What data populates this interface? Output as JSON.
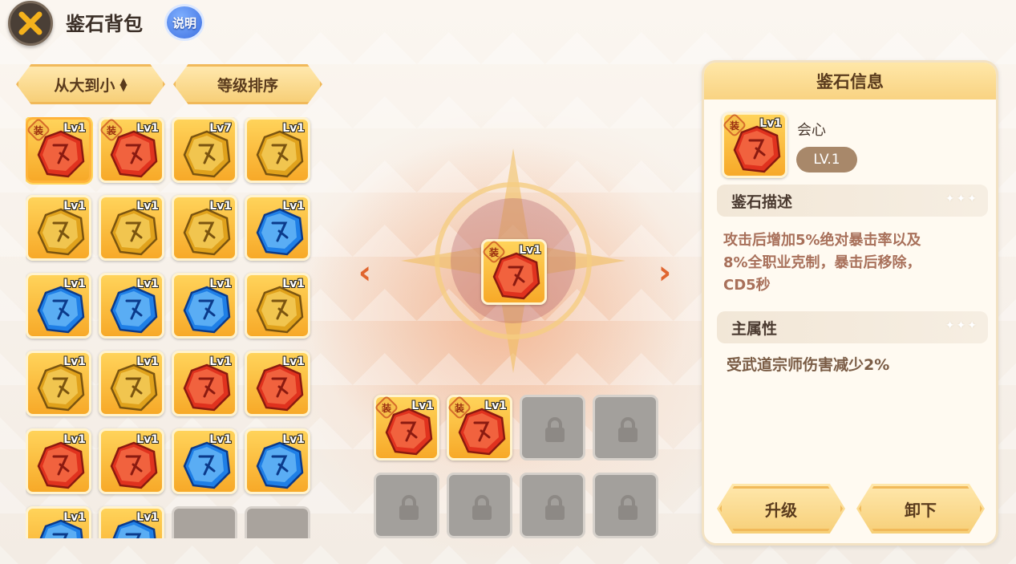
{
  "header": {
    "title": "鉴石背包",
    "help_label": "说明"
  },
  "sort": {
    "order_label": "从大到小",
    "level_label": "等级排序"
  },
  "equip_tag": "装",
  "bag": [
    {
      "color": "red",
      "lv": "Lv1",
      "equipped": true,
      "selected": true
    },
    {
      "color": "red",
      "lv": "Lv1",
      "equipped": true
    },
    {
      "color": "gold",
      "lv": "Lv7"
    },
    {
      "color": "gold",
      "lv": "Lv1"
    },
    {
      "color": "gold",
      "lv": "Lv1"
    },
    {
      "color": "gold",
      "lv": "Lv1"
    },
    {
      "color": "gold",
      "lv": "Lv1"
    },
    {
      "color": "blue",
      "lv": "Lv1"
    },
    {
      "color": "blue",
      "lv": "Lv1"
    },
    {
      "color": "blue",
      "lv": "Lv1"
    },
    {
      "color": "blue",
      "lv": "Lv1"
    },
    {
      "color": "gold",
      "lv": "Lv1"
    },
    {
      "color": "gold",
      "lv": "Lv1"
    },
    {
      "color": "gold",
      "lv": "Lv1"
    },
    {
      "color": "red",
      "lv": "Lv1"
    },
    {
      "color": "red",
      "lv": "Lv1"
    },
    {
      "color": "red",
      "lv": "Lv1"
    },
    {
      "color": "red",
      "lv": "Lv1"
    },
    {
      "color": "blue",
      "lv": "Lv1"
    },
    {
      "color": "blue",
      "lv": "Lv1"
    },
    {
      "color": "blue",
      "lv": "Lv1"
    },
    {
      "color": "blue",
      "lv": "Lv1"
    },
    {
      "color": "empty"
    },
    {
      "color": "empty"
    }
  ],
  "center_slot": {
    "color": "red",
    "lv": "Lv1",
    "equipped": true
  },
  "equipped_slots": [
    {
      "state": "gem",
      "color": "red",
      "lv": "Lv1",
      "equipped": true
    },
    {
      "state": "gem",
      "color": "red",
      "lv": "Lv1",
      "equipped": true
    },
    {
      "state": "locked"
    },
    {
      "state": "locked"
    },
    {
      "state": "locked"
    },
    {
      "state": "locked"
    },
    {
      "state": "locked"
    },
    {
      "state": "locked"
    }
  ],
  "info": {
    "title": "鉴石信息",
    "gem_name": "会心",
    "gem_lv": "Lv1",
    "level_badge": "LV.1",
    "desc_title": "鉴石描述",
    "desc_lines": [
      "攻击后增加5%绝对暴击率以及",
      "8%全职业克制，暴击后移除，",
      "CD5秒"
    ],
    "attr_title": "主属性",
    "attr_value": "受武道宗师伤害减少2%",
    "upgrade_label": "升级",
    "unequip_label": "卸下"
  },
  "colors": {
    "red": [
      "#ff8a5a",
      "#e0321e",
      "#8a1a10"
    ],
    "gold": [
      "#ffe27a",
      "#e0a21c",
      "#7a5410"
    ],
    "blue": [
      "#8ad4ff",
      "#1f7fe6",
      "#0b3a8a"
    ],
    "accent": "#f7cf78"
  }
}
